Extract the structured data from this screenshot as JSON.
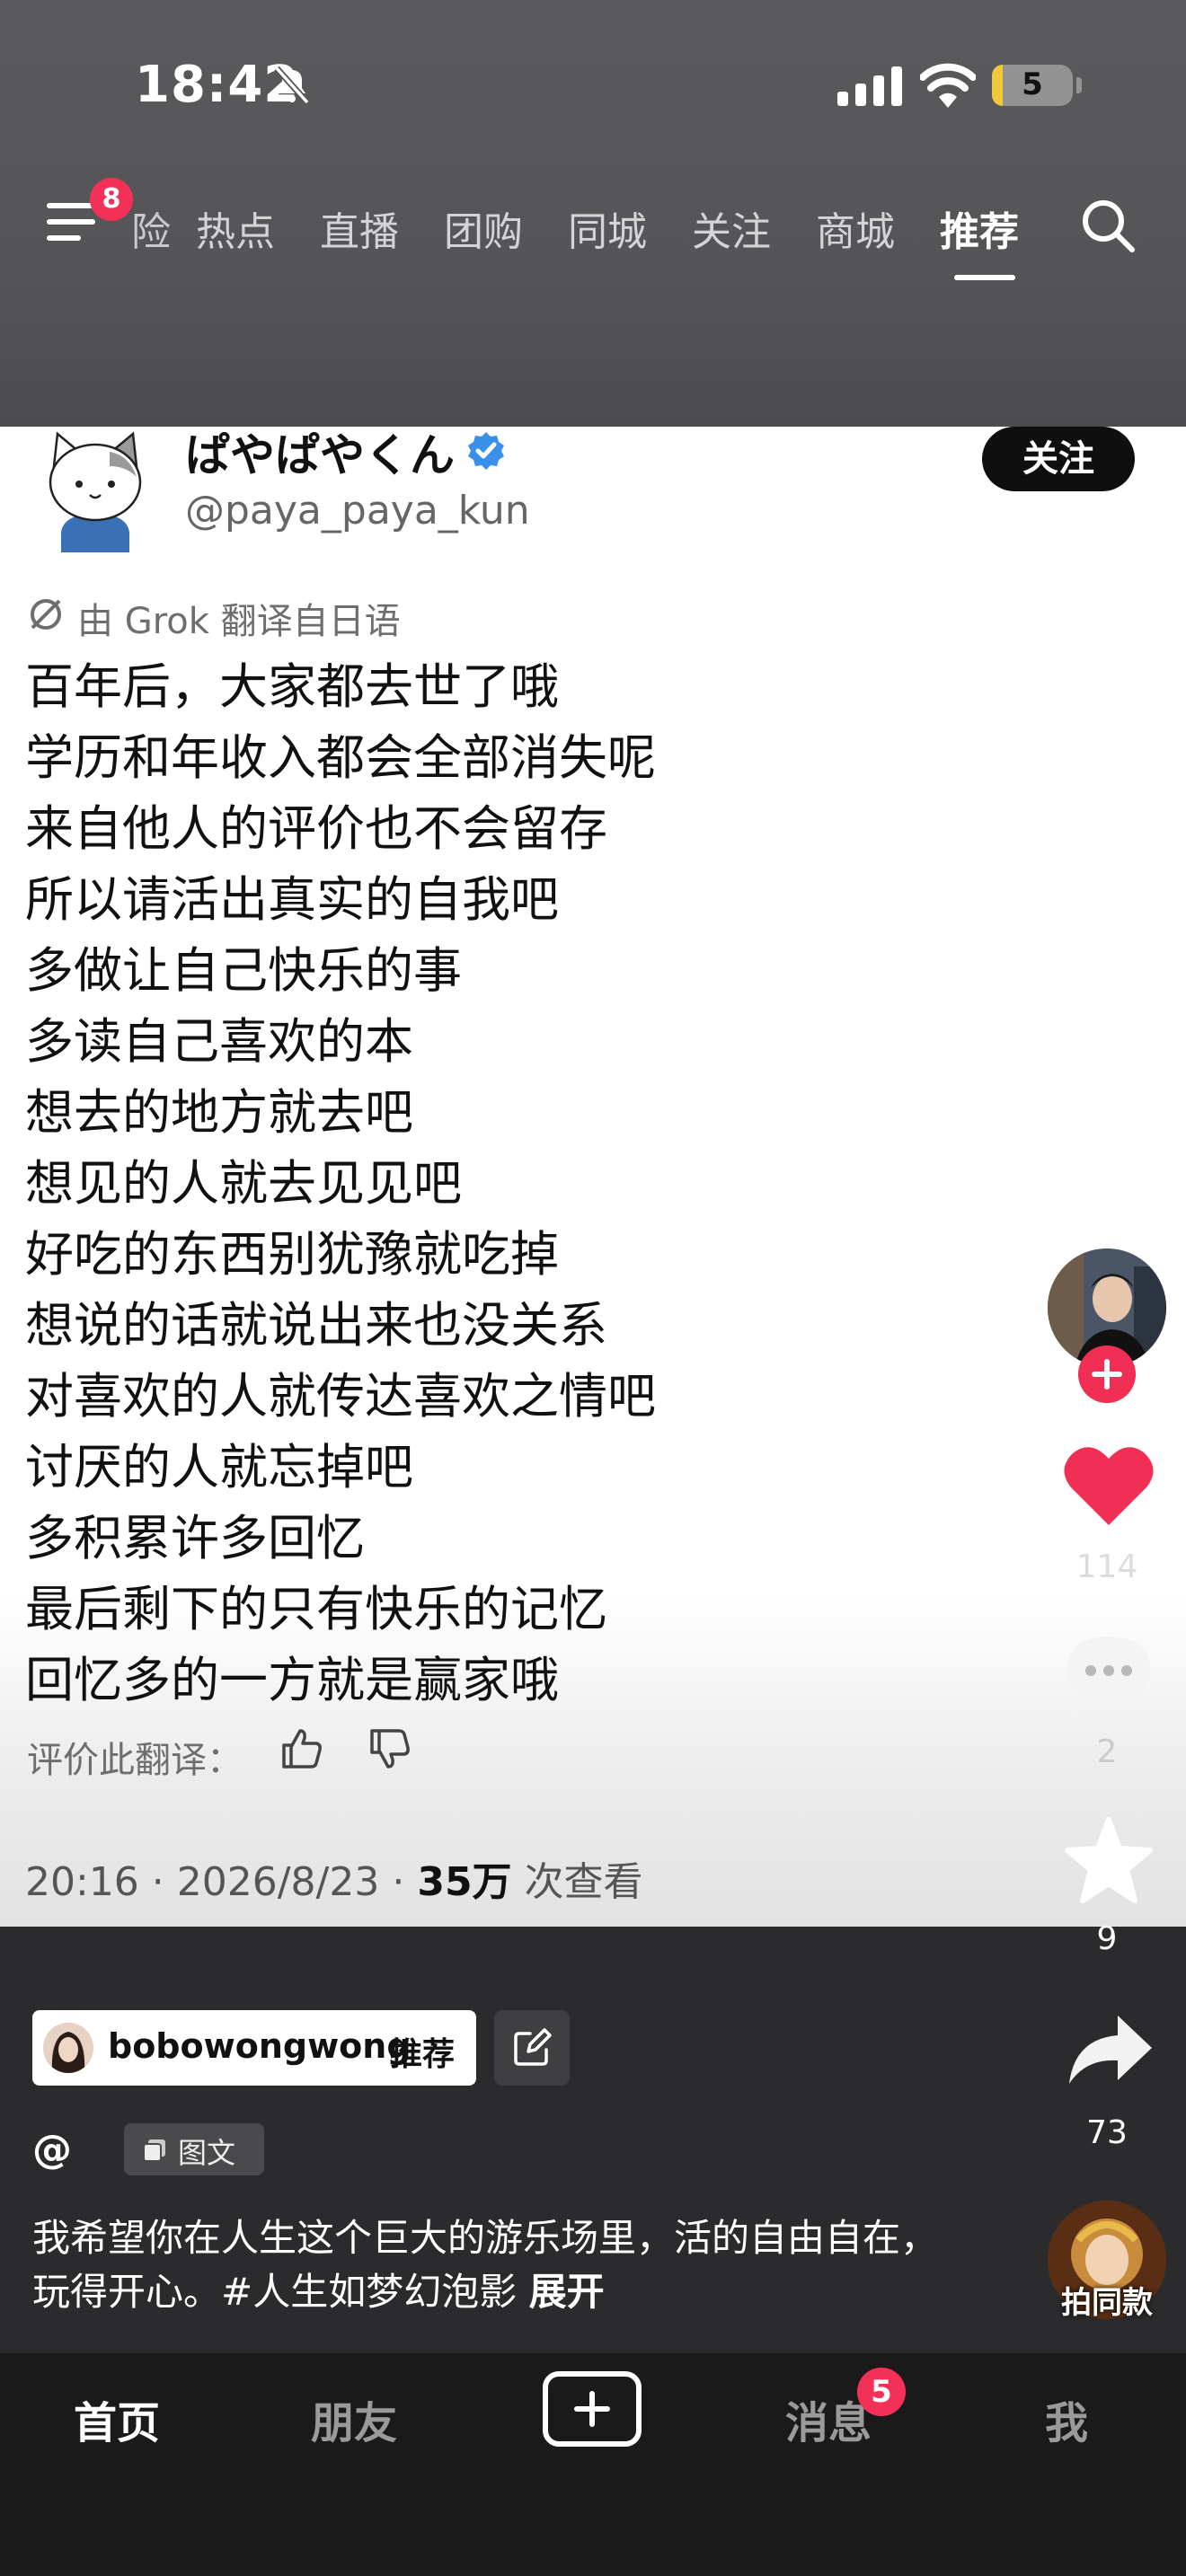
{
  "status_bar": {
    "time": "18:42",
    "battery": "5"
  },
  "top_nav": {
    "menu_badge": "8",
    "partial_tab": "险",
    "tabs": [
      {
        "label": "热点"
      },
      {
        "label": "直播"
      },
      {
        "label": "团购"
      },
      {
        "label": "同城"
      },
      {
        "label": "关注"
      },
      {
        "label": "商城"
      },
      {
        "label": "推荐"
      }
    ],
    "active_tab": "推荐"
  },
  "post": {
    "poster_name": "ぱやぱやくん",
    "poster_handle": "@paya_paya_kun",
    "follow_label": "关注",
    "translate_note": "由 Grok 翻译自日语",
    "lines": [
      "百年后，大家都去世了哦",
      "学历和年收入都会全部消失呢",
      "来自他人的评价也不会留存",
      "所以请活出真实的自我吧",
      "多做让自己快乐的事",
      "多读自己喜欢的本",
      "想去的地方就去吧",
      "想见的人就去见见吧",
      "好吃的东西别犹豫就吃掉",
      "想说的话就说出来也没关系",
      "对喜欢的人就传达喜欢之情吧",
      "讨厌的人就忘掉吧",
      "多积累许多回忆",
      "最后剩下的只有快乐的记忆",
      "回忆多的一方就是赢家哦"
    ],
    "rate_label": "评价此翻译：",
    "timestamp": "20:16 · 2026/8/23 · ",
    "views": "35万",
    "views_suffix": " 次查看"
  },
  "actions": {
    "likes": "114",
    "comments": "2",
    "favorites": "9",
    "shares": "73",
    "music_label": "拍同款"
  },
  "info": {
    "recommender": "bobowongwong",
    "rec_tag": "推荐",
    "at_sign": "@",
    "type_label": "图文",
    "caption": "我希望你在人生这个巨大的游乐场里，活的自由自在，玩得开心。#人生如梦幻泡影",
    "expand_label": "展开"
  },
  "bottom_nav": {
    "home": "首页",
    "friends": "朋友",
    "messages": "消息",
    "messages_badge": "5",
    "me": "我"
  },
  "colors": {
    "accent_red": "#f33058",
    "heart_red": "#f12e54",
    "verified_blue": "#3a8fe8"
  }
}
